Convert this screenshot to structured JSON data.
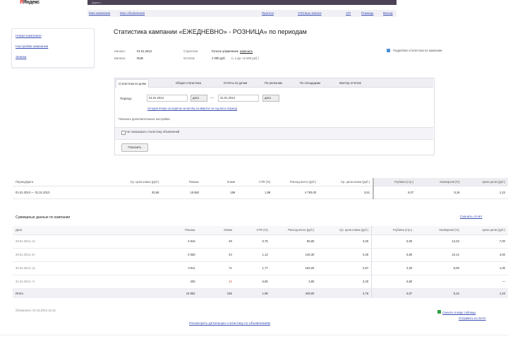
{
  "header": {
    "logo_text": "Яндекс",
    "topbar_label": "Директ",
    "nav_left": [
      "Мои кампании",
      "Мои объявления"
    ],
    "nav_right": [
      "Прогноз",
      "Учётные записи",
      "API",
      "Помощь",
      "Выход"
    ]
  },
  "sidebar": {
    "items": [
      "Новая кампания",
      "Настройки кампании",
      "Заявки"
    ]
  },
  "page_title": "Статистика кампании «ЕЖЕДНЕВНО» - РОЗНИЦА» по периодам",
  "info": {
    "left_keys": [
      "Начало:",
      "Валюта:"
    ],
    "left_vals": [
      "01.01.2013",
      "RUB"
    ],
    "mid_keys": [
      "Стратегия:",
      "Остаток:"
    ],
    "mid_vals": [
      "Ручное управление",
      "1 000 руб."
    ],
    "strategy_link": "изменить",
    "remaining_extra": "(≈ 2 дн. по 500 руб.)",
    "notice": "Подробная статистика по кампании"
  },
  "filter": {
    "tabs": [
      "Статистика по дням",
      "Общая статистика",
      "Отчёты по датам",
      "По регионам",
      "По площадкам",
      "Мастер отчётов"
    ],
    "active_tab": 0,
    "period_label": "Период:",
    "date_from": "01.01.2013",
    "date_to": "31.01.2013",
    "date_button": "дата",
    "dash": "—",
    "presets": "сегодня  вчера  за неделю  за месяц  за квартал  за год  весь период",
    "show_more": "Показать дополнительные настройки",
    "checkbox_label": "Не показывать статистику объявлений",
    "show_button": "Показать"
  },
  "summary": {
    "headers": [
      "Период/Дата",
      "Ср. цена клика (руб.)",
      "Показы",
      "Клики",
      "CTR (%)",
      "Расход всего (руб.)",
      "Ср. цена клика (руб.)",
      "Глубина (стр.)",
      "Конверсия (%)",
      "Цена цели (руб.)"
    ],
    "row": [
      "01.01.2013 — 31.01.2013",
      "30,66",
      "15 862",
      "156",
      "1,98",
      "4 783,00",
      "3,61",
      "5,07",
      "8,16",
      "1,23"
    ]
  },
  "daily": {
    "title": "Суммарные данные по кампании",
    "link": "Скачать отчёт",
    "headers": [
      "Дата",
      "Показы",
      "Клики",
      "CTR (%)",
      "Расход всего (руб.)",
      "Ср. цена клика (руб.)",
      "Глубина (стр.)",
      "Конверсия (%)",
      "Цена цели (руб.)"
    ],
    "rows": [
      [
        "28.01.2013, пн",
        "3 816",
        "29",
        "0,76",
        "86,80",
        "3,00",
        "5,00",
        "13,33",
        "7,00"
      ],
      [
        "29.01.2013, вт",
        "3 938",
        "44",
        "1,12",
        "146,30",
        "3,30",
        "5,80",
        "10,12",
        "4,00"
      ],
      [
        "30.01.2013, ср",
        "3 911",
        "71",
        "1,77",
        "193,20",
        "2,67",
        "4,20",
        "8,08",
        "1,00"
      ],
      [
        "31.01.2013, чт",
        "205",
        "12",
        "5,85",
        "3,80",
        "3,20",
        "6,80",
        "",
        "—"
      ]
    ],
    "total": [
      "Итого",
      "15 862",
      "156",
      "1,98",
      "429,00",
      "2,76",
      "5,07",
      "8,16",
      "1,23"
    ]
  },
  "footer": {
    "updated": "Обновлено: 01.02.2013 10:16",
    "right_link1": "Скачать в виде таблицы",
    "right_link2": "Отправить по почте",
    "center_link": "Посмотреть детальную статистику по объявлениям"
  },
  "colors": {
    "topbar": "#4c4356",
    "link": "#3b4fb3",
    "notice_icon": "#4a90d9",
    "excel_icon": "#2e9e3e"
  }
}
